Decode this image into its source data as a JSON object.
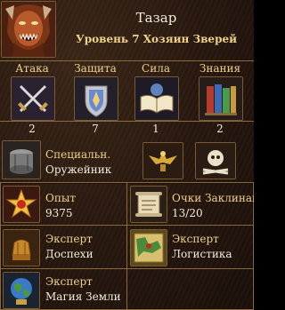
{
  "hero": {
    "name": "Тазар",
    "subtitle": "Уровень 7 Хозяин Зверей",
    "portrait_icon": "berserker-portrait-icon"
  },
  "primary_skills": [
    {
      "label": "Атака",
      "value": "2",
      "icon": "crossed-swords-icon"
    },
    {
      "label": "Защита",
      "value": "7",
      "icon": "shield-icon"
    },
    {
      "label": "Сила",
      "value": "1",
      "icon": "open-spellbook-icon"
    },
    {
      "label": "Знания",
      "value": "2",
      "icon": "books-icon"
    }
  ],
  "specialty": {
    "label": "Специальн.",
    "value": "Оружейник",
    "icon": "armor-drum-icon"
  },
  "flags": [
    {
      "icon": "eagle-emblem-icon"
    },
    {
      "icon": "skull-bones-icon"
    }
  ],
  "experience": {
    "label": "Опыт",
    "value": "9375",
    "icon": "star-medal-icon"
  },
  "spell_points": {
    "label": "Очки Заклинаний",
    "value": "13/20",
    "icon": "scroll-icon"
  },
  "secondary_skills": [
    {
      "level": "Эксперт",
      "name": "Доспехи",
      "icon": "armor-gauntlet-icon"
    },
    {
      "level": "Эксперт",
      "name": "Логистика",
      "icon": "map-board-icon"
    },
    {
      "level": "Эксперт",
      "name": "Магия Земли",
      "icon": "earth-globe-icon"
    }
  ],
  "colors": {
    "frame": "#8a6a3c",
    "label_gold": "#efd28a",
    "text": "#f3ecd8",
    "background": "#2a1a10"
  }
}
